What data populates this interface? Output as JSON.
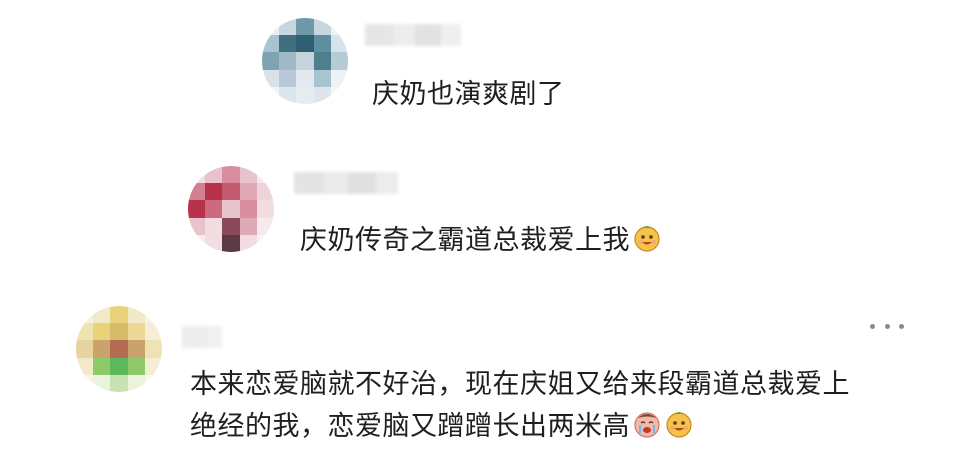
{
  "comments": [
    {
      "text": "庆奶也演爽剧了",
      "emojis": []
    },
    {
      "text": "庆奶传奇之霸道总裁爱上我",
      "emojis": [
        "grinning-face-emoji"
      ]
    },
    {
      "lines": [
        "本来恋爱脑就不好治，现在庆姐又给来段霸道总裁爱上",
        "绝经的我，恋爱脑又蹭蹭长出两米高"
      ],
      "emojis": [
        "crying-face-emoji",
        "grinning-face-emoji"
      ]
    }
  ],
  "more_icon": "more-horizontal-icon",
  "colors": {
    "text": "#1f1f1f",
    "more_dots": "#8a8a8a",
    "avatar1": [
      "#7fa3b0",
      "#3f6f7f",
      "#a9c4d1",
      "#5d8fa0",
      "#d7e2ea"
    ],
    "avatar2": [
      "#b7324a",
      "#d98ea0",
      "#e7c3cc",
      "#8a4a5c",
      "#f1dde2"
    ],
    "avatar3": [
      "#e8d27a",
      "#c9a36b",
      "#b56a52",
      "#5cb85a",
      "#f2e9c9"
    ]
  }
}
